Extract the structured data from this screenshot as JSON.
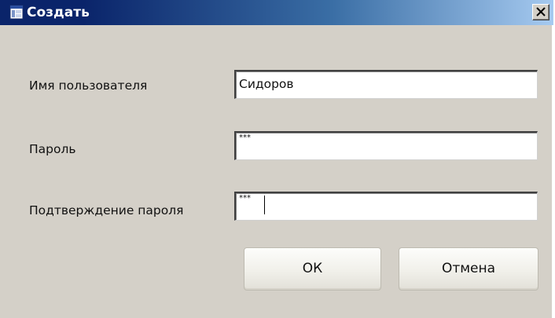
{
  "dialog": {
    "title": "Создать",
    "close_glyph": "×"
  },
  "fields": [
    {
      "label": "Имя пользователя",
      "value": "Сидоров"
    },
    {
      "label": "Пароль",
      "value": "***"
    },
    {
      "label": "Подтверждение пароля",
      "value": "***"
    }
  ],
  "buttons": {
    "ok_label": "ОК",
    "cancel_label": "Отмена"
  },
  "colors": {
    "titlebar_start": "#0a246a",
    "titlebar_end": "#a6caf0",
    "dialog_bg": "#d4d0c8"
  },
  "icons": {
    "title_icon": "window-app-icon",
    "close_icon": "close-icon"
  }
}
